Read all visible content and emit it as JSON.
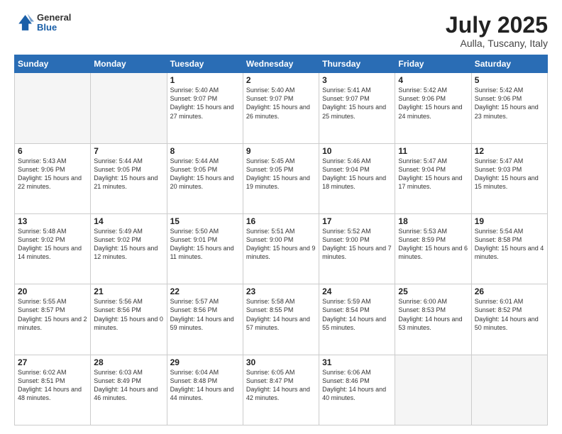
{
  "header": {
    "logo_general": "General",
    "logo_blue": "Blue",
    "month_title": "July 2025",
    "location": "Aulla, Tuscany, Italy"
  },
  "days_of_week": [
    "Sunday",
    "Monday",
    "Tuesday",
    "Wednesday",
    "Thursday",
    "Friday",
    "Saturday"
  ],
  "weeks": [
    [
      {
        "day": "",
        "empty": true
      },
      {
        "day": "",
        "empty": true
      },
      {
        "day": "1",
        "sunrise": "5:40 AM",
        "sunset": "9:07 PM",
        "daylight": "15 hours and 27 minutes."
      },
      {
        "day": "2",
        "sunrise": "5:40 AM",
        "sunset": "9:07 PM",
        "daylight": "15 hours and 26 minutes."
      },
      {
        "day": "3",
        "sunrise": "5:41 AM",
        "sunset": "9:07 PM",
        "daylight": "15 hours and 25 minutes."
      },
      {
        "day": "4",
        "sunrise": "5:42 AM",
        "sunset": "9:06 PM",
        "daylight": "15 hours and 24 minutes."
      },
      {
        "day": "5",
        "sunrise": "5:42 AM",
        "sunset": "9:06 PM",
        "daylight": "15 hours and 23 minutes."
      }
    ],
    [
      {
        "day": "6",
        "sunrise": "5:43 AM",
        "sunset": "9:06 PM",
        "daylight": "15 hours and 22 minutes."
      },
      {
        "day": "7",
        "sunrise": "5:44 AM",
        "sunset": "9:05 PM",
        "daylight": "15 hours and 21 minutes."
      },
      {
        "day": "8",
        "sunrise": "5:44 AM",
        "sunset": "9:05 PM",
        "daylight": "15 hours and 20 minutes."
      },
      {
        "day": "9",
        "sunrise": "5:45 AM",
        "sunset": "9:05 PM",
        "daylight": "15 hours and 19 minutes."
      },
      {
        "day": "10",
        "sunrise": "5:46 AM",
        "sunset": "9:04 PM",
        "daylight": "15 hours and 18 minutes."
      },
      {
        "day": "11",
        "sunrise": "5:47 AM",
        "sunset": "9:04 PM",
        "daylight": "15 hours and 17 minutes."
      },
      {
        "day": "12",
        "sunrise": "5:47 AM",
        "sunset": "9:03 PM",
        "daylight": "15 hours and 15 minutes."
      }
    ],
    [
      {
        "day": "13",
        "sunrise": "5:48 AM",
        "sunset": "9:02 PM",
        "daylight": "15 hours and 14 minutes."
      },
      {
        "day": "14",
        "sunrise": "5:49 AM",
        "sunset": "9:02 PM",
        "daylight": "15 hours and 12 minutes."
      },
      {
        "day": "15",
        "sunrise": "5:50 AM",
        "sunset": "9:01 PM",
        "daylight": "15 hours and 11 minutes."
      },
      {
        "day": "16",
        "sunrise": "5:51 AM",
        "sunset": "9:00 PM",
        "daylight": "15 hours and 9 minutes."
      },
      {
        "day": "17",
        "sunrise": "5:52 AM",
        "sunset": "9:00 PM",
        "daylight": "15 hours and 7 minutes."
      },
      {
        "day": "18",
        "sunrise": "5:53 AM",
        "sunset": "8:59 PM",
        "daylight": "15 hours and 6 minutes."
      },
      {
        "day": "19",
        "sunrise": "5:54 AM",
        "sunset": "8:58 PM",
        "daylight": "15 hours and 4 minutes."
      }
    ],
    [
      {
        "day": "20",
        "sunrise": "5:55 AM",
        "sunset": "8:57 PM",
        "daylight": "15 hours and 2 minutes."
      },
      {
        "day": "21",
        "sunrise": "5:56 AM",
        "sunset": "8:56 PM",
        "daylight": "15 hours and 0 minutes."
      },
      {
        "day": "22",
        "sunrise": "5:57 AM",
        "sunset": "8:56 PM",
        "daylight": "14 hours and 59 minutes."
      },
      {
        "day": "23",
        "sunrise": "5:58 AM",
        "sunset": "8:55 PM",
        "daylight": "14 hours and 57 minutes."
      },
      {
        "day": "24",
        "sunrise": "5:59 AM",
        "sunset": "8:54 PM",
        "daylight": "14 hours and 55 minutes."
      },
      {
        "day": "25",
        "sunrise": "6:00 AM",
        "sunset": "8:53 PM",
        "daylight": "14 hours and 53 minutes."
      },
      {
        "day": "26",
        "sunrise": "6:01 AM",
        "sunset": "8:52 PM",
        "daylight": "14 hours and 50 minutes."
      }
    ],
    [
      {
        "day": "27",
        "sunrise": "6:02 AM",
        "sunset": "8:51 PM",
        "daylight": "14 hours and 48 minutes."
      },
      {
        "day": "28",
        "sunrise": "6:03 AM",
        "sunset": "8:49 PM",
        "daylight": "14 hours and 46 minutes."
      },
      {
        "day": "29",
        "sunrise": "6:04 AM",
        "sunset": "8:48 PM",
        "daylight": "14 hours and 44 minutes."
      },
      {
        "day": "30",
        "sunrise": "6:05 AM",
        "sunset": "8:47 PM",
        "daylight": "14 hours and 42 minutes."
      },
      {
        "day": "31",
        "sunrise": "6:06 AM",
        "sunset": "8:46 PM",
        "daylight": "14 hours and 40 minutes."
      },
      {
        "day": "",
        "empty": true
      },
      {
        "day": "",
        "empty": true
      }
    ]
  ]
}
